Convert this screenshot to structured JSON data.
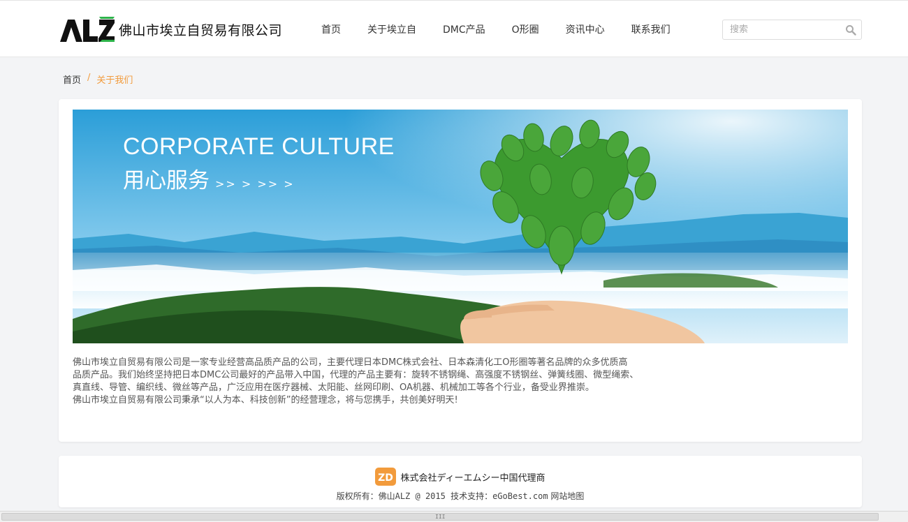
{
  "header": {
    "logo_text": "佛山市埃立自贸易有限公司",
    "logo_mark": "ALZ",
    "nav": [
      "首页",
      "关于埃立自",
      "DMC产品",
      "O形圈",
      "资讯中心",
      "联系我们"
    ],
    "search_placeholder": "搜索",
    "search_icon": "search-icon"
  },
  "breadcrumb": {
    "home": "首页",
    "separator": "/",
    "current": "关于我们"
  },
  "banner": {
    "title": "CORPORATE CULTURE",
    "subtitle": "用心服务",
    "arrows": ">> >  >> >"
  },
  "about": {
    "lines": [
      "佛山市埃立自贸易有限公司是一家专业经营高品质产品的公司，主要代理日本DMC株式会社、日本森清化工O形圈等著名品牌的众多优质高",
      "品质产品。我们始终坚持把日本DMC公司最好的产品带入中国，代理的产品主要有：旋转不锈钢绳、高强度不锈钢丝、弹簧线圈、微型绳索、",
      "真直线、导管、编织线、微丝等产品，广泛应用在医疗器械、太阳能、丝网印刷、OA机器、机械加工等各个行业，备受业界推崇。",
      "佛山市埃立自贸易有限公司秉承“以人为本、科技创新”的经营理念，将与您携手，共创美好明天!"
    ]
  },
  "footer": {
    "partner_logo": "ZD",
    "partner_text": "株式会社ディーエムシー中国代理商",
    "copyright_label": "版权所有：",
    "copyright_body": "佛山ALZ @ 2015 技术支持：eGoBest.com",
    "sitemap": "网站地图"
  },
  "colors": {
    "accent": "#f29b3c",
    "logo_green": "#2db34a",
    "page_bg": "#f3f4f6"
  },
  "scrollbar": {
    "grip": "III"
  }
}
